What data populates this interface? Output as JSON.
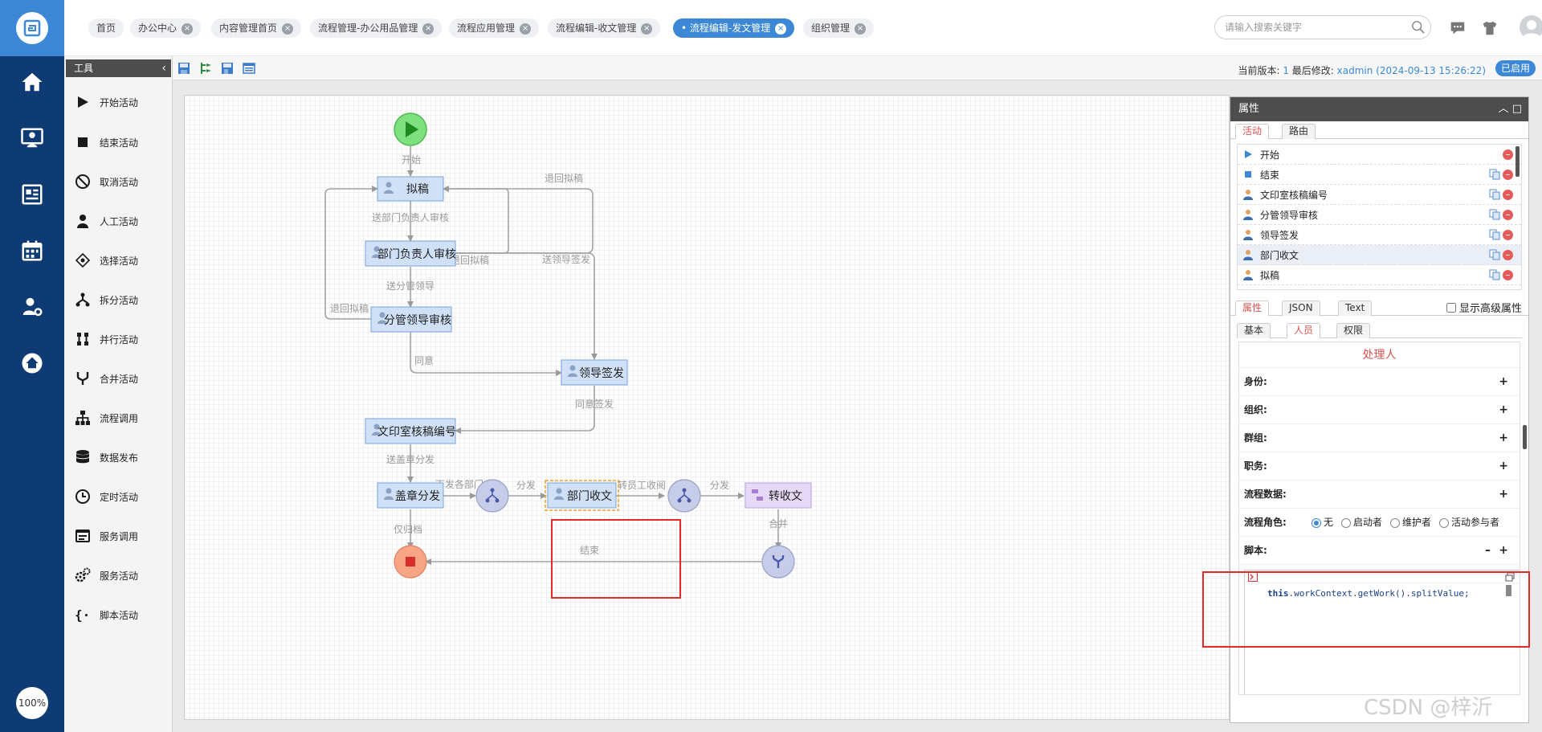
{
  "nav": {
    "zoom": "100%"
  },
  "tabs": [
    {
      "label": "首页",
      "closable": false,
      "active": false
    },
    {
      "label": "办公中心",
      "closable": true,
      "active": false
    },
    {
      "label": "内容管理首页",
      "closable": true,
      "active": false
    },
    {
      "label": "流程管理-办公用品管理",
      "closable": true,
      "active": false
    },
    {
      "label": "流程应用管理",
      "closable": true,
      "active": false
    },
    {
      "label": "流程编辑-收文管理",
      "closable": true,
      "active": false
    },
    {
      "label": "流程编辑-发文管理",
      "closable": true,
      "active": true
    },
    {
      "label": "组织管理",
      "closable": true,
      "active": false
    }
  ],
  "search": {
    "placeholder": "请输入搜索关键字"
  },
  "user": {
    "name": "xadmin"
  },
  "tools": {
    "title": "工具",
    "items": [
      {
        "label": "开始活动",
        "icon": "play-icon"
      },
      {
        "label": "结束活动",
        "icon": "stop-icon"
      },
      {
        "label": "取消活动",
        "icon": "cancel-icon"
      },
      {
        "label": "人工活动",
        "icon": "user-icon"
      },
      {
        "label": "选择活动",
        "icon": "choice-icon"
      },
      {
        "label": "拆分活动",
        "icon": "split-icon"
      },
      {
        "label": "并行活动",
        "icon": "parallel-icon"
      },
      {
        "label": "合并活动",
        "icon": "merge-icon"
      },
      {
        "label": "流程调用",
        "icon": "subprocess-icon"
      },
      {
        "label": "数据发布",
        "icon": "database-icon"
      },
      {
        "label": "定时活动",
        "icon": "clock-icon"
      },
      {
        "label": "服务调用",
        "icon": "service-call-icon"
      },
      {
        "label": "服务活动",
        "icon": "gears-icon"
      },
      {
        "label": "脚本活动",
        "icon": "script-icon"
      }
    ]
  },
  "version": {
    "label": "当前版本:",
    "number": "1",
    "modified_label": "最后修改:",
    "modified_value": "xadmin (2024-09-13 15:26:22)",
    "status": "已启用"
  },
  "flow": {
    "nodes": {
      "start": {
        "label": ""
      },
      "draft": {
        "label": "拟稿"
      },
      "dept_review": {
        "label": "部门负责人审核"
      },
      "leader_review": {
        "label": "分管领导审核"
      },
      "leader_sign": {
        "label": "领导签发"
      },
      "office_number": {
        "label": "文印室核稿编号"
      },
      "stamp": {
        "label": "盖章分发"
      },
      "dept_receive": {
        "label": "部门收文"
      },
      "to_receive": {
        "label": "转收文"
      },
      "split1": {
        "label": ""
      },
      "split2": {
        "label": ""
      },
      "merge": {
        "label": ""
      },
      "end": {
        "label": ""
      }
    },
    "edges": {
      "e_start": "开始",
      "e_back_draft_top": "退回拟稿",
      "e_to_dept": "送部门负责人审核",
      "e_back_draft_dept": "退回拟稿",
      "e_to_leader_sign": "送领导签发",
      "e_to_leader_review": "送分管领导",
      "e_back_draft_left": "退回拟稿",
      "e_agree": "同意",
      "e_agree_sign": "同意签发",
      "e_to_stamp": "送盖章分发",
      "e_to_depts": "下发各部门",
      "e_split1": "分发",
      "e_transfer": "转员工收阅",
      "e_split2": "分发",
      "e_archive": "仅归档",
      "e_merge": "合并",
      "e_end": "结束"
    }
  },
  "properties": {
    "title": "属性",
    "top_tabs": [
      "活动",
      "路由"
    ],
    "activities": [
      {
        "label": "开始",
        "icon": "start-triangle-icon",
        "copy": false,
        "selected": false
      },
      {
        "label": "结束",
        "icon": "end-square-icon",
        "copy": true,
        "selected": false
      },
      {
        "label": "文印室核稿编号",
        "icon": "person-icon",
        "copy": true,
        "selected": false
      },
      {
        "label": "分管领导审核",
        "icon": "person-icon",
        "copy": true,
        "selected": false
      },
      {
        "label": "领导签发",
        "icon": "person-icon",
        "copy": true,
        "selected": false
      },
      {
        "label": "部门收文",
        "icon": "person-icon",
        "copy": true,
        "selected": true
      },
      {
        "label": "拟稿",
        "icon": "person-icon",
        "copy": true,
        "selected": false
      }
    ],
    "sub_tabs": [
      "属性",
      "JSON",
      "Text"
    ],
    "advanced_label": "显示高级属性",
    "detail_tabs": [
      "基本",
      "人员",
      "权限"
    ],
    "handler_title": "处理人",
    "fields": {
      "identity": "身份:",
      "org": "组织:",
      "group": "群组:",
      "duty": "职务:",
      "flowdata": "流程数据:",
      "role": "流程角色:",
      "script": "脚本:"
    },
    "role_options": [
      "无",
      "启动者",
      "维护者",
      "活动参与者"
    ],
    "script_code_kw": "this",
    "script_code_rest": ".workContext.getWork().splitValue;"
  },
  "watermark": "CSDN @梓沂"
}
